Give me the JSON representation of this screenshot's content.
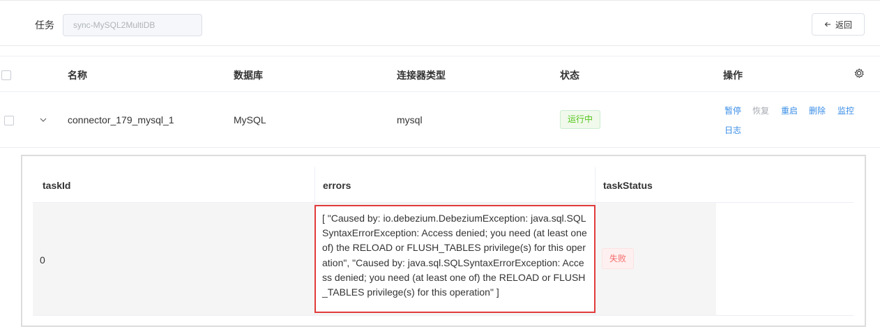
{
  "header": {
    "task_label": "任务",
    "task_value": "sync-MySQL2MultiDB",
    "back_label": "返回"
  },
  "table": {
    "columns": [
      "名称",
      "数据库",
      "连接器类型",
      "状态",
      "操作"
    ],
    "rows": [
      {
        "name": "connector_179_mysql_1",
        "database": "MySQL",
        "connector_type": "mysql",
        "status": "运行中",
        "actions": [
          "暂停",
          "恢复",
          "重启",
          "删除",
          "监控",
          "日志"
        ]
      }
    ]
  },
  "detail": {
    "columns": [
      "taskId",
      "errors",
      "taskStatus"
    ],
    "rows": [
      {
        "taskId": "0",
        "errors": "[ \"Caused by: io.debezium.DebeziumException: java.sql.SQLSyntaxErrorException: Access denied; you need (at least one of) the RELOAD or FLUSH_TABLES privilege(s) for this operation\", \"Caused by: java.sql.SQLSyntaxErrorException: Access denied; you need (at least one of) the RELOAD or FLUSH_TABLES privilege(s) for this operation\" ]",
        "taskStatus": "失败"
      }
    ]
  },
  "colors": {
    "link": "#3a8ee6",
    "running_green": "#52c41a",
    "fail_red": "#f56c6c",
    "highlight_border": "#e03a3a"
  },
  "icons": {
    "back": "arrow-left-icon",
    "settings": "gear-icon",
    "expand": "chevron-down-icon"
  }
}
